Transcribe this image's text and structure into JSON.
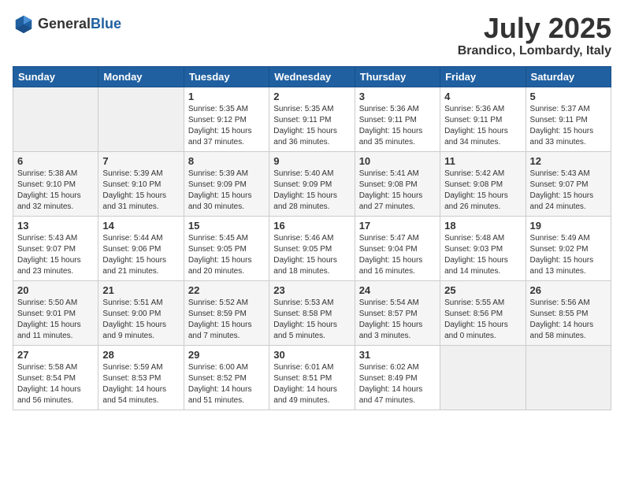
{
  "header": {
    "logo_general": "General",
    "logo_blue": "Blue",
    "month_title": "July 2025",
    "location": "Brandico, Lombardy, Italy"
  },
  "weekdays": [
    "Sunday",
    "Monday",
    "Tuesday",
    "Wednesday",
    "Thursday",
    "Friday",
    "Saturday"
  ],
  "weeks": [
    [
      {
        "day": "",
        "detail": ""
      },
      {
        "day": "",
        "detail": ""
      },
      {
        "day": "1",
        "detail": "Sunrise: 5:35 AM\nSunset: 9:12 PM\nDaylight: 15 hours and 37 minutes."
      },
      {
        "day": "2",
        "detail": "Sunrise: 5:35 AM\nSunset: 9:11 PM\nDaylight: 15 hours and 36 minutes."
      },
      {
        "day": "3",
        "detail": "Sunrise: 5:36 AM\nSunset: 9:11 PM\nDaylight: 15 hours and 35 minutes."
      },
      {
        "day": "4",
        "detail": "Sunrise: 5:36 AM\nSunset: 9:11 PM\nDaylight: 15 hours and 34 minutes."
      },
      {
        "day": "5",
        "detail": "Sunrise: 5:37 AM\nSunset: 9:11 PM\nDaylight: 15 hours and 33 minutes."
      }
    ],
    [
      {
        "day": "6",
        "detail": "Sunrise: 5:38 AM\nSunset: 9:10 PM\nDaylight: 15 hours and 32 minutes."
      },
      {
        "day": "7",
        "detail": "Sunrise: 5:39 AM\nSunset: 9:10 PM\nDaylight: 15 hours and 31 minutes."
      },
      {
        "day": "8",
        "detail": "Sunrise: 5:39 AM\nSunset: 9:09 PM\nDaylight: 15 hours and 30 minutes."
      },
      {
        "day": "9",
        "detail": "Sunrise: 5:40 AM\nSunset: 9:09 PM\nDaylight: 15 hours and 28 minutes."
      },
      {
        "day": "10",
        "detail": "Sunrise: 5:41 AM\nSunset: 9:08 PM\nDaylight: 15 hours and 27 minutes."
      },
      {
        "day": "11",
        "detail": "Sunrise: 5:42 AM\nSunset: 9:08 PM\nDaylight: 15 hours and 26 minutes."
      },
      {
        "day": "12",
        "detail": "Sunrise: 5:43 AM\nSunset: 9:07 PM\nDaylight: 15 hours and 24 minutes."
      }
    ],
    [
      {
        "day": "13",
        "detail": "Sunrise: 5:43 AM\nSunset: 9:07 PM\nDaylight: 15 hours and 23 minutes."
      },
      {
        "day": "14",
        "detail": "Sunrise: 5:44 AM\nSunset: 9:06 PM\nDaylight: 15 hours and 21 minutes."
      },
      {
        "day": "15",
        "detail": "Sunrise: 5:45 AM\nSunset: 9:05 PM\nDaylight: 15 hours and 20 minutes."
      },
      {
        "day": "16",
        "detail": "Sunrise: 5:46 AM\nSunset: 9:05 PM\nDaylight: 15 hours and 18 minutes."
      },
      {
        "day": "17",
        "detail": "Sunrise: 5:47 AM\nSunset: 9:04 PM\nDaylight: 15 hours and 16 minutes."
      },
      {
        "day": "18",
        "detail": "Sunrise: 5:48 AM\nSunset: 9:03 PM\nDaylight: 15 hours and 14 minutes."
      },
      {
        "day": "19",
        "detail": "Sunrise: 5:49 AM\nSunset: 9:02 PM\nDaylight: 15 hours and 13 minutes."
      }
    ],
    [
      {
        "day": "20",
        "detail": "Sunrise: 5:50 AM\nSunset: 9:01 PM\nDaylight: 15 hours and 11 minutes."
      },
      {
        "day": "21",
        "detail": "Sunrise: 5:51 AM\nSunset: 9:00 PM\nDaylight: 15 hours and 9 minutes."
      },
      {
        "day": "22",
        "detail": "Sunrise: 5:52 AM\nSunset: 8:59 PM\nDaylight: 15 hours and 7 minutes."
      },
      {
        "day": "23",
        "detail": "Sunrise: 5:53 AM\nSunset: 8:58 PM\nDaylight: 15 hours and 5 minutes."
      },
      {
        "day": "24",
        "detail": "Sunrise: 5:54 AM\nSunset: 8:57 PM\nDaylight: 15 hours and 3 minutes."
      },
      {
        "day": "25",
        "detail": "Sunrise: 5:55 AM\nSunset: 8:56 PM\nDaylight: 15 hours and 0 minutes."
      },
      {
        "day": "26",
        "detail": "Sunrise: 5:56 AM\nSunset: 8:55 PM\nDaylight: 14 hours and 58 minutes."
      }
    ],
    [
      {
        "day": "27",
        "detail": "Sunrise: 5:58 AM\nSunset: 8:54 PM\nDaylight: 14 hours and 56 minutes."
      },
      {
        "day": "28",
        "detail": "Sunrise: 5:59 AM\nSunset: 8:53 PM\nDaylight: 14 hours and 54 minutes."
      },
      {
        "day": "29",
        "detail": "Sunrise: 6:00 AM\nSunset: 8:52 PM\nDaylight: 14 hours and 51 minutes."
      },
      {
        "day": "30",
        "detail": "Sunrise: 6:01 AM\nSunset: 8:51 PM\nDaylight: 14 hours and 49 minutes."
      },
      {
        "day": "31",
        "detail": "Sunrise: 6:02 AM\nSunset: 8:49 PM\nDaylight: 14 hours and 47 minutes."
      },
      {
        "day": "",
        "detail": ""
      },
      {
        "day": "",
        "detail": ""
      }
    ]
  ]
}
